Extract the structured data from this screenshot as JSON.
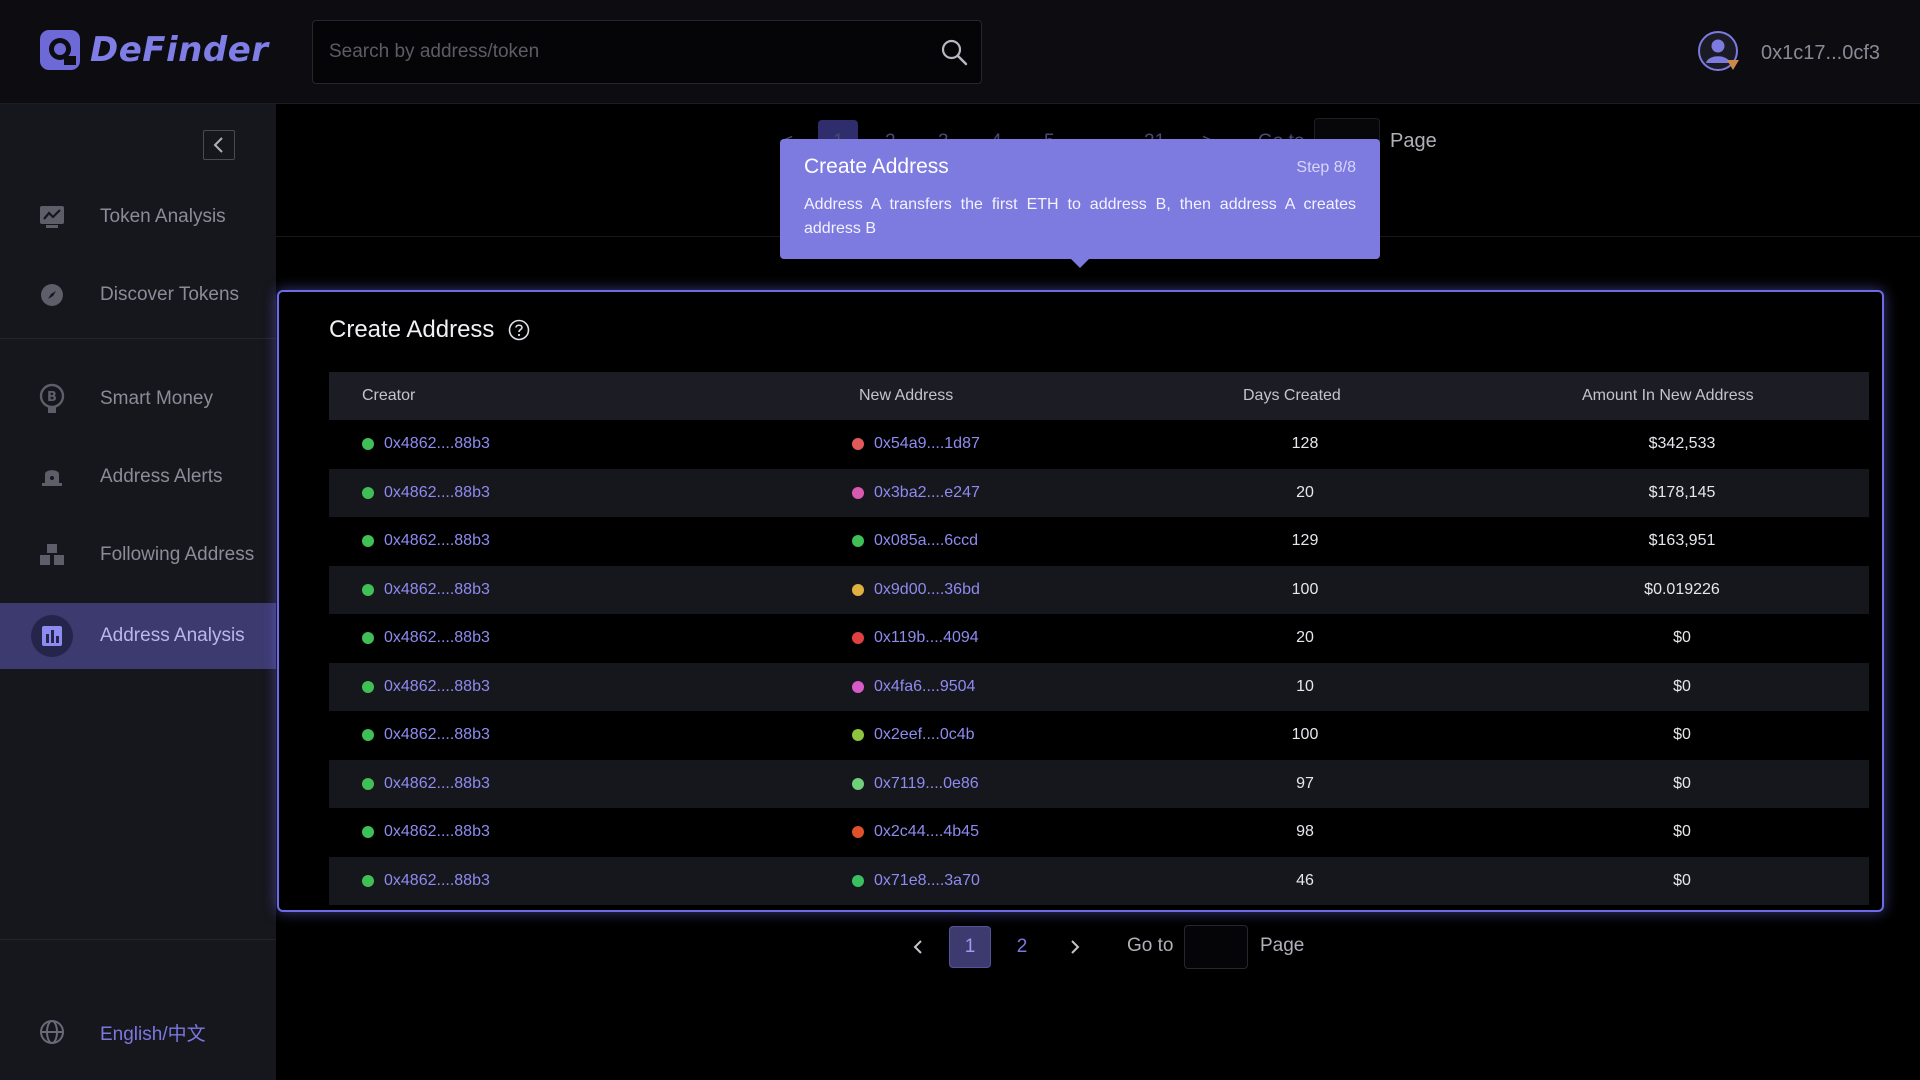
{
  "app": {
    "logo_text": "DeFinder"
  },
  "search": {
    "placeholder": "Search by address/token"
  },
  "user": {
    "address": "0x1c17...0cf3"
  },
  "sidebar": {
    "items": [
      {
        "label": "Token Analysis",
        "icon": "chart-board-icon"
      },
      {
        "label": "Discover Tokens",
        "icon": "compass-icon"
      },
      {
        "label": "Smart Money",
        "icon": "bitcoin-bulb-icon"
      },
      {
        "label": "Address Alerts",
        "icon": "bell-icon"
      },
      {
        "label": "Following Address",
        "icon": "boxes-icon"
      },
      {
        "label": "Address Analysis",
        "icon": "bar-chart-icon",
        "active": true
      }
    ],
    "language": "English/中文"
  },
  "top_pagination": {
    "pages": [
      "1",
      "2",
      "3",
      "4",
      "5",
      "...",
      "21"
    ],
    "goto_label": "Go to",
    "page_label": "Page"
  },
  "tooltip": {
    "title": "Create Address",
    "step": "Step 8/8",
    "body": "Address A transfers the first ETH to address B, then address A creates address B"
  },
  "card": {
    "title": "Create Address",
    "columns": [
      "Creator",
      "New Address",
      "Days Created",
      "Amount In New Address"
    ],
    "rows": [
      {
        "creator": "0x4862....88b3",
        "new_address": "0x54a9....1d87",
        "days": "128",
        "amount": "$342,533",
        "dot": "#e05a5a"
      },
      {
        "creator": "0x4862....88b3",
        "new_address": "0x3ba2....e247",
        "days": "20",
        "amount": "$178,145",
        "dot": "#d85ab0"
      },
      {
        "creator": "0x4862....88b3",
        "new_address": "0x085a....6ccd",
        "days": "129",
        "amount": "$163,951",
        "dot": "#3fbf55"
      },
      {
        "creator": "0x4862....88b3",
        "new_address": "0x9d00....36bd",
        "days": "100",
        "amount": "$0.019226",
        "dot": "#e0b040"
      },
      {
        "creator": "0x4862....88b3",
        "new_address": "0x119b....4094",
        "days": "20",
        "amount": "$0",
        "dot": "#e04040"
      },
      {
        "creator": "0x4862....88b3",
        "new_address": "0x4fa6....9504",
        "days": "10",
        "amount": "$0",
        "dot": "#d85ac8"
      },
      {
        "creator": "0x4862....88b3",
        "new_address": "0x2eef....0c4b",
        "days": "100",
        "amount": "$0",
        "dot": "#8fc43e"
      },
      {
        "creator": "0x4862....88b3",
        "new_address": "0x7119....0e86",
        "days": "97",
        "amount": "$0",
        "dot": "#6fd07a"
      },
      {
        "creator": "0x4862....88b3",
        "new_address": "0x2c44....4b45",
        "days": "98",
        "amount": "$0",
        "dot": "#e0502a"
      },
      {
        "creator": "0x4862....88b3",
        "new_address": "0x71e8....3a70",
        "days": "46",
        "amount": "$0",
        "dot": "#3ac060"
      }
    ]
  },
  "pagination": {
    "prev": "<",
    "pages": [
      "1",
      "2"
    ],
    "current": "1",
    "next": ">",
    "goto_label": "Go to",
    "page_label": "Page"
  },
  "colors": {
    "accent": "#7d7ae0",
    "active_nav": "#3d3a70",
    "creator_dot": "#3fbf55"
  }
}
